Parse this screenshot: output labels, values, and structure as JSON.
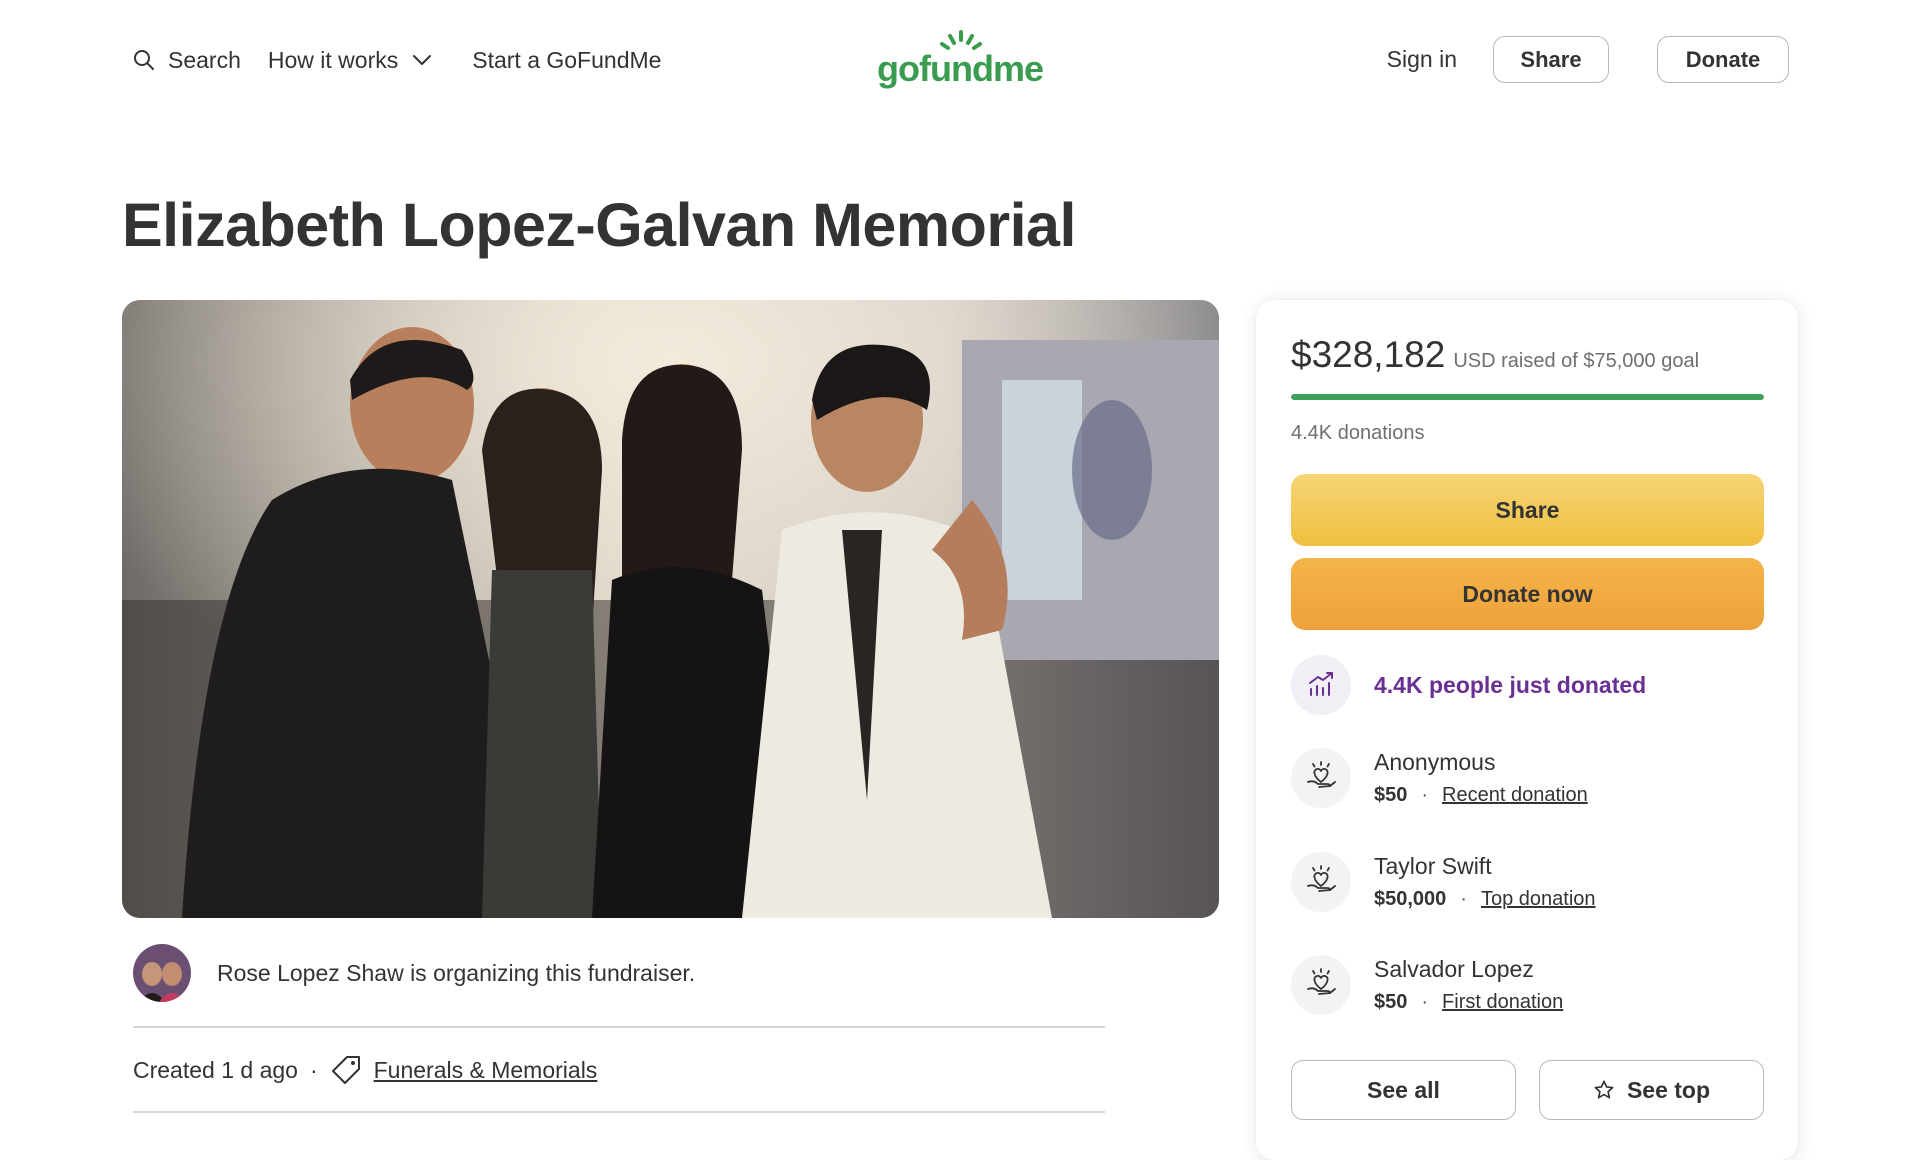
{
  "nav": {
    "search_label": "Search",
    "how_it_works_label": "How it works",
    "start_label": "Start a GoFundMe",
    "logo_text": "gofundme",
    "signin_label": "Sign in",
    "share_label": "Share",
    "donate_label": "Donate"
  },
  "page": {
    "title": "Elizabeth Lopez-Galvan Memorial"
  },
  "organizer": {
    "text": "Rose Lopez Shaw is organizing this fundraiser."
  },
  "meta": {
    "created": "Created 1 d ago",
    "separator": "·",
    "category": "Funerals & Memorials"
  },
  "fundraiser": {
    "raised_amount": "$328,182",
    "raised_label": "USD raised of $75,000 goal",
    "progress_fraction": 1.0,
    "donations_count": "4.4K donations",
    "share_button": "Share",
    "donate_button": "Donate now",
    "trend_text": "4.4K people just donated",
    "donors": [
      {
        "name": "Anonymous",
        "amount": "$50",
        "badge": "Recent donation"
      },
      {
        "name": "Taylor Swift",
        "amount": "$50,000",
        "badge": "Top donation"
      },
      {
        "name": "Salvador Lopez",
        "amount": "$50",
        "badge": "First donation"
      }
    ],
    "dot": "·",
    "see_all_button": "See all",
    "see_top_button": "See top"
  },
  "colors": {
    "brand_green": "#3a9c4f",
    "progress_green": "#3fa05a",
    "share_yellow": "#efbf3f",
    "donate_orange": "#eea13a",
    "trend_purple": "#6a2f93"
  },
  "icons": {
    "search": "search-icon",
    "chevron": "chevron-down-icon",
    "tag": "tag-icon",
    "trend": "trending-up-icon",
    "donor": "heart-hand-icon",
    "star": "star-icon"
  }
}
